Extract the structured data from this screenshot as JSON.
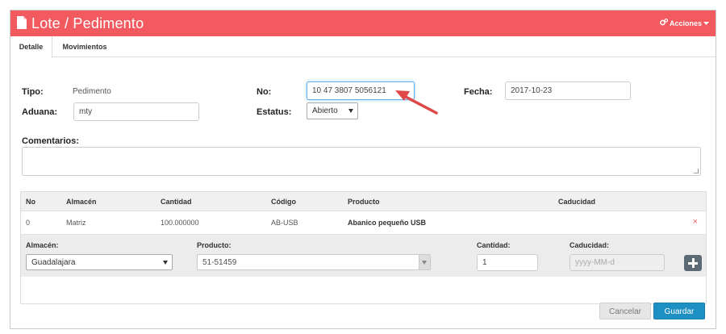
{
  "header": {
    "title": "Lote / Pedimento",
    "actions_label": "Acciones",
    "accent": "#f25a5f"
  },
  "tabs": [
    {
      "label": "Detalle",
      "active": true
    },
    {
      "label": "Movimientos",
      "active": false
    }
  ],
  "form": {
    "tipo_label": "Tipo:",
    "tipo_value": "Pedimento",
    "aduana_label": "Aduana:",
    "aduana_value": "mty",
    "no_label": "No:",
    "no_value": "10 47 3807 5056121",
    "estatus_label": "Estatus:",
    "estatus_value": "Abierto",
    "fecha_label": "Fecha:",
    "fecha_value": "2017-10-23",
    "comentarios_label": "Comentarios:"
  },
  "table": {
    "headers": [
      "No",
      "Almacén",
      "Cantidad",
      "Código",
      "Producto",
      "Caducidad"
    ],
    "rows": [
      {
        "no": "0",
        "almacen": "Matriz",
        "cantidad": "100.000000",
        "codigo": "AB-USB",
        "producto": "Abanico pequeño USB",
        "caducidad": ""
      }
    ],
    "remove_icon": "×"
  },
  "add_form": {
    "almacen_label": "Almacén:",
    "almacen_value": "Guadalajara",
    "producto_label": "Producto:",
    "producto_value": "51-51459",
    "cantidad_label": "Cantidad:",
    "cantidad_value": "1",
    "caducidad_label": "Caducidad:",
    "caducidad_placeholder": "yyyy-MM-d"
  },
  "buttons": {
    "cancel": "Cancelar",
    "save": "Guardar"
  }
}
